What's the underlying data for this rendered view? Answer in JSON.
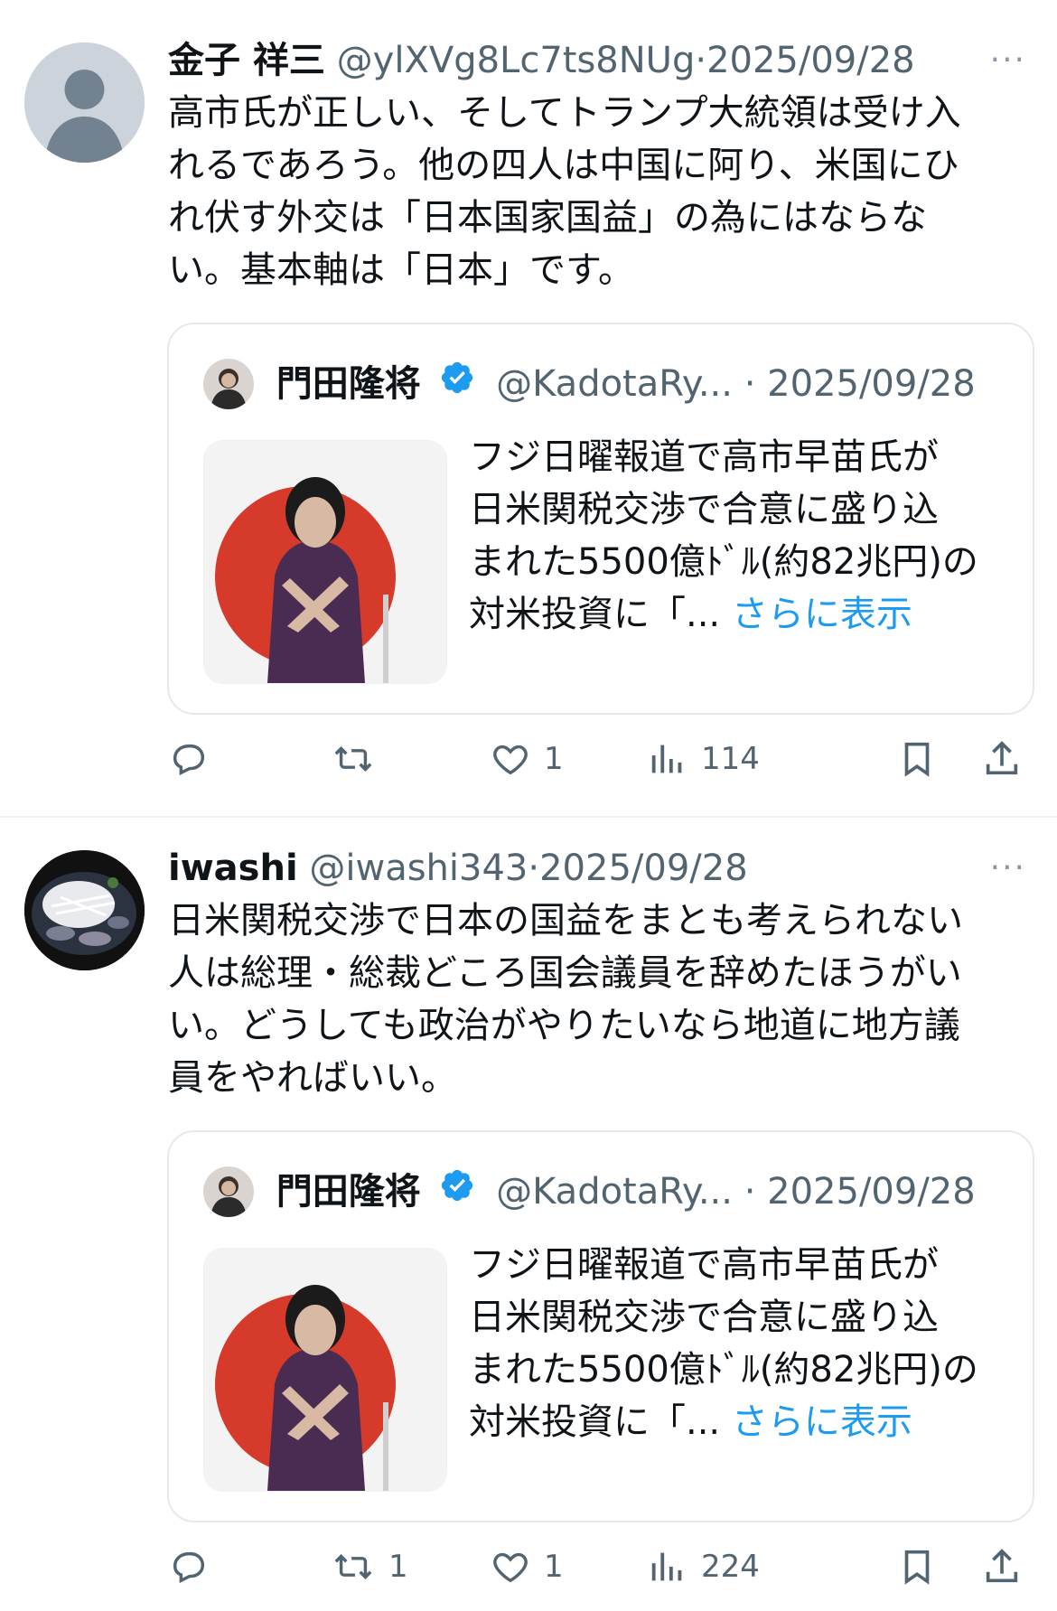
{
  "tweets": [
    {
      "author_name": "金子 祥三",
      "handle": "@ylXVg8Lc7ts8NUg",
      "date": "2025/09/28",
      "text": "高市氏が正しい、そしてトランプ大統領は受け入\nれるであろう。他の四人は中国に阿り、米国にひ\nれ伏す外交は「日本国家国益」の為にはならな\nい。基本軸は「日本」です。",
      "quote": {
        "author_name": "門田隆将",
        "handle": "@KadotaRy...",
        "date": "2025/09/28",
        "text": "フジ日曜報道で高市早苗氏が\n日米関税交渉で合意に盛り込\nまれた5500億ﾄﾞﾙ(約82兆円)の\n対米投資に「... ",
        "show_more": "さらに表示"
      },
      "actions": {
        "reply": "",
        "retweet": "",
        "like": "1",
        "views": "114"
      }
    },
    {
      "author_name": "iwashi",
      "handle": "@iwashi343",
      "date": "2025/09/28",
      "text": "日米関税交渉で日本の国益をまとも考えられない\n人は総理・総裁どころ国会議員を辞めたほうがい\nい。どうしても政治がやりたいなら地道に地方議\n員をやればいい。",
      "quote": {
        "author_name": "門田隆将",
        "handle": "@KadotaRy...",
        "date": "2025/09/28",
        "text": "フジ日曜報道で高市早苗氏が\n日米関税交渉で合意に盛り込\nまれた5500億ﾄﾞﾙ(約82兆円)の\n対米投資に「... ",
        "show_more": "さらに表示"
      },
      "actions": {
        "reply": "",
        "retweet": "1",
        "like": "1",
        "views": "224"
      }
    }
  ],
  "separator": "·",
  "more_glyph": "···",
  "icons": [
    "reply-icon",
    "retweet-icon",
    "like-icon",
    "views-icon",
    "bookmark-icon",
    "share-icon",
    "verified-badge-icon",
    "more-icon"
  ],
  "colors": {
    "text": "#0f1419",
    "muted": "#536471",
    "link": "#1d9bf0",
    "verified": "#1d9bf0",
    "border": "#e6e9ec"
  }
}
